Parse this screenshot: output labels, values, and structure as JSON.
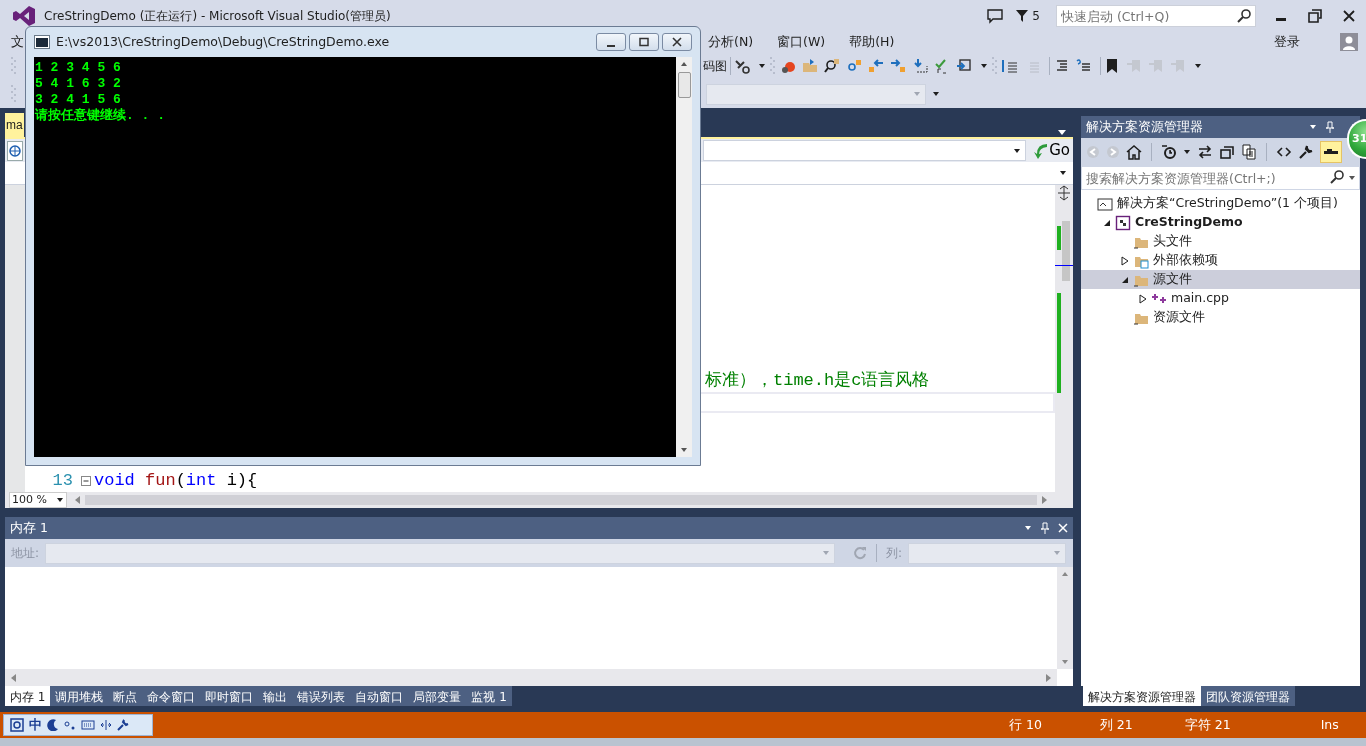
{
  "window": {
    "title": "CreStringDemo (正在运行) - Microsoft Visual Studio(管理员)",
    "notification_count": "5",
    "quick_launch": {
      "placeholder": "快速启动 (Ctrl+Q)"
    },
    "sign_in": "登录"
  },
  "menu": [
    "文",
    "分析(N)",
    "窗口(W)",
    "帮助(H)"
  ],
  "toolbar": {
    "label_fragment": "码图"
  },
  "editor": {
    "tab": {
      "label": "ma",
      "selected": true
    },
    "go_button": "Go",
    "comment_fragment": "标准），time.h是c语言风格",
    "current_line": true,
    "lines": [
      {
        "number": "13",
        "tokens": [
          {
            "text": "void",
            "kind": "keyword"
          },
          {
            "text": " fun",
            "kind": "function"
          },
          {
            "text": "(",
            "kind": "plain"
          },
          {
            "text": "int",
            "kind": "keyword"
          },
          {
            "text": " i){",
            "kind": "plain"
          }
        ]
      }
    ],
    "zoom": "100 %"
  },
  "console": {
    "title": "E:\\vs2013\\CreStringDemo\\Debug\\CreStringDemo.exe",
    "lines": [
      "1 2 3 4 5 6",
      "5 4 1 6 3 2",
      "3 2 4 1 5 6",
      "请按任意键继续. . ."
    ]
  },
  "solution_explorer": {
    "title": "解决方案资源管理器",
    "search": {
      "placeholder": "搜索解决方案资源管理器(Ctrl+;)"
    },
    "tree": [
      {
        "label": "解决方案“CreStringDemo”(1 个项目)",
        "kind": "solution",
        "selected": false,
        "children": [
          {
            "label": "CreStringDemo",
            "kind": "project",
            "expanded": true,
            "selected": false,
            "children": [
              {
                "label": "头文件",
                "kind": "folder",
                "selected": false
              },
              {
                "label": "外部依赖项",
                "kind": "references",
                "expanded": false,
                "selected": false
              },
              {
                "label": "源文件",
                "kind": "folder",
                "expanded": true,
                "selected": true,
                "children": [
                  {
                    "label": "main.cpp",
                    "kind": "file",
                    "expanded": false,
                    "selected": false
                  }
                ]
              },
              {
                "label": "资源文件",
                "kind": "folder",
                "selected": false
              }
            ]
          }
        ]
      }
    ]
  },
  "notification_badge": "31",
  "memory": {
    "title": "内存 1",
    "address_label": "地址:",
    "column_label": "列:"
  },
  "bottom_tabs": [
    {
      "label": "内存 1",
      "selected": true
    },
    {
      "label": "调用堆栈",
      "selected": false
    },
    {
      "label": "断点",
      "selected": false
    },
    {
      "label": "命令窗口",
      "selected": false
    },
    {
      "label": "即时窗口",
      "selected": false
    },
    {
      "label": "输出",
      "selected": false
    },
    {
      "label": "错误列表",
      "selected": false
    },
    {
      "label": "自动窗口",
      "selected": false
    },
    {
      "label": "局部变量",
      "selected": false
    },
    {
      "label": "监视 1",
      "selected": false
    }
  ],
  "side_tabs": [
    {
      "label": "解决方案资源管理器",
      "selected": true
    },
    {
      "label": "团队资源管理器",
      "selected": false
    }
  ],
  "ime_bar": {
    "mode": "中"
  },
  "status_bar": {
    "line": "行 10",
    "column": "列 21",
    "character": "字符 21",
    "mode": "Ins"
  }
}
